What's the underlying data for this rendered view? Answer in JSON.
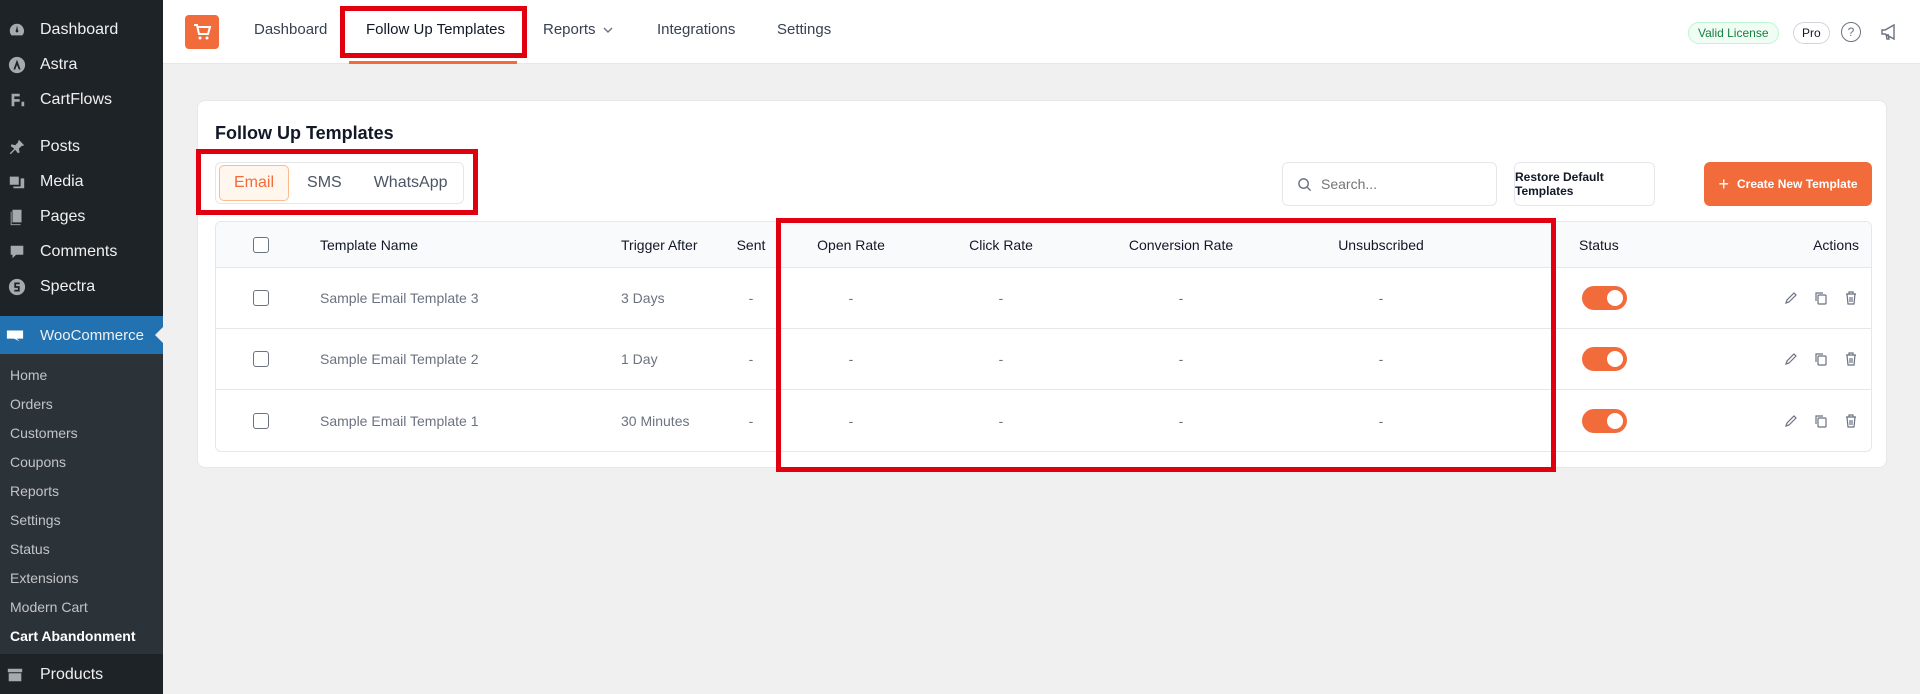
{
  "wp_menu": {
    "top_items": [
      {
        "label": "Dashboard",
        "icon": "dashboard-icon"
      },
      {
        "label": "Astra",
        "icon": "astra-icon"
      },
      {
        "label": "CartFlows",
        "icon": "cartflows-icon"
      }
    ],
    "content_items": [
      {
        "label": "Posts",
        "icon": "pin-icon"
      },
      {
        "label": "Media",
        "icon": "media-icon"
      },
      {
        "label": "Pages",
        "icon": "pages-icon"
      },
      {
        "label": "Comments",
        "icon": "comment-icon"
      },
      {
        "label": "Spectra",
        "icon": "spectra-icon"
      }
    ],
    "woocommerce": {
      "label": "WooCommerce",
      "icon": "woo-icon"
    },
    "woo_sub_items": [
      "Home",
      "Orders",
      "Customers",
      "Coupons",
      "Reports",
      "Settings",
      "Status",
      "Extensions",
      "Modern Cart",
      "Cart Abandonment"
    ],
    "products": {
      "label": "Products",
      "icon": "archive-icon"
    }
  },
  "topnav": {
    "items": [
      "Dashboard",
      "Follow Up Templates",
      "Reports",
      "Integrations",
      "Settings"
    ],
    "active": "Follow Up Templates",
    "license": "Valid License",
    "plan": "Pro"
  },
  "page": {
    "title": "Follow Up Templates",
    "tabs": [
      "Email",
      "SMS",
      "WhatsApp"
    ],
    "active_tab": "Email",
    "search_placeholder": "Search...",
    "restore_button": "Restore Default Templates",
    "create_button": "Create New Template"
  },
  "table": {
    "headers": {
      "name": "Template Name",
      "trigger": "Trigger After",
      "sent": "Sent",
      "open_rate": "Open Rate",
      "click_rate": "Click Rate",
      "conversion_rate": "Conversion Rate",
      "unsubscribed": "Unsubscribed",
      "status": "Status",
      "actions": "Actions"
    },
    "rows": [
      {
        "name": "Sample Email Template 3",
        "trigger": "3 Days",
        "sent": "-",
        "open_rate": "-",
        "click_rate": "-",
        "conversion_rate": "-",
        "unsubscribed": "-",
        "status": "on"
      },
      {
        "name": "Sample Email Template 2",
        "trigger": "1 Day",
        "sent": "-",
        "open_rate": "-",
        "click_rate": "-",
        "conversion_rate": "-",
        "unsubscribed": "-",
        "status": "on"
      },
      {
        "name": "Sample Email Template 1",
        "trigger": "30 Minutes",
        "sent": "-",
        "open_rate": "-",
        "click_rate": "-",
        "conversion_rate": "-",
        "unsubscribed": "-",
        "status": "on"
      }
    ]
  },
  "colors": {
    "accent": "#f26b3a",
    "highlight": "#e00010",
    "wp_sidebar": "#1d2327",
    "wp_active": "#2271b1"
  }
}
